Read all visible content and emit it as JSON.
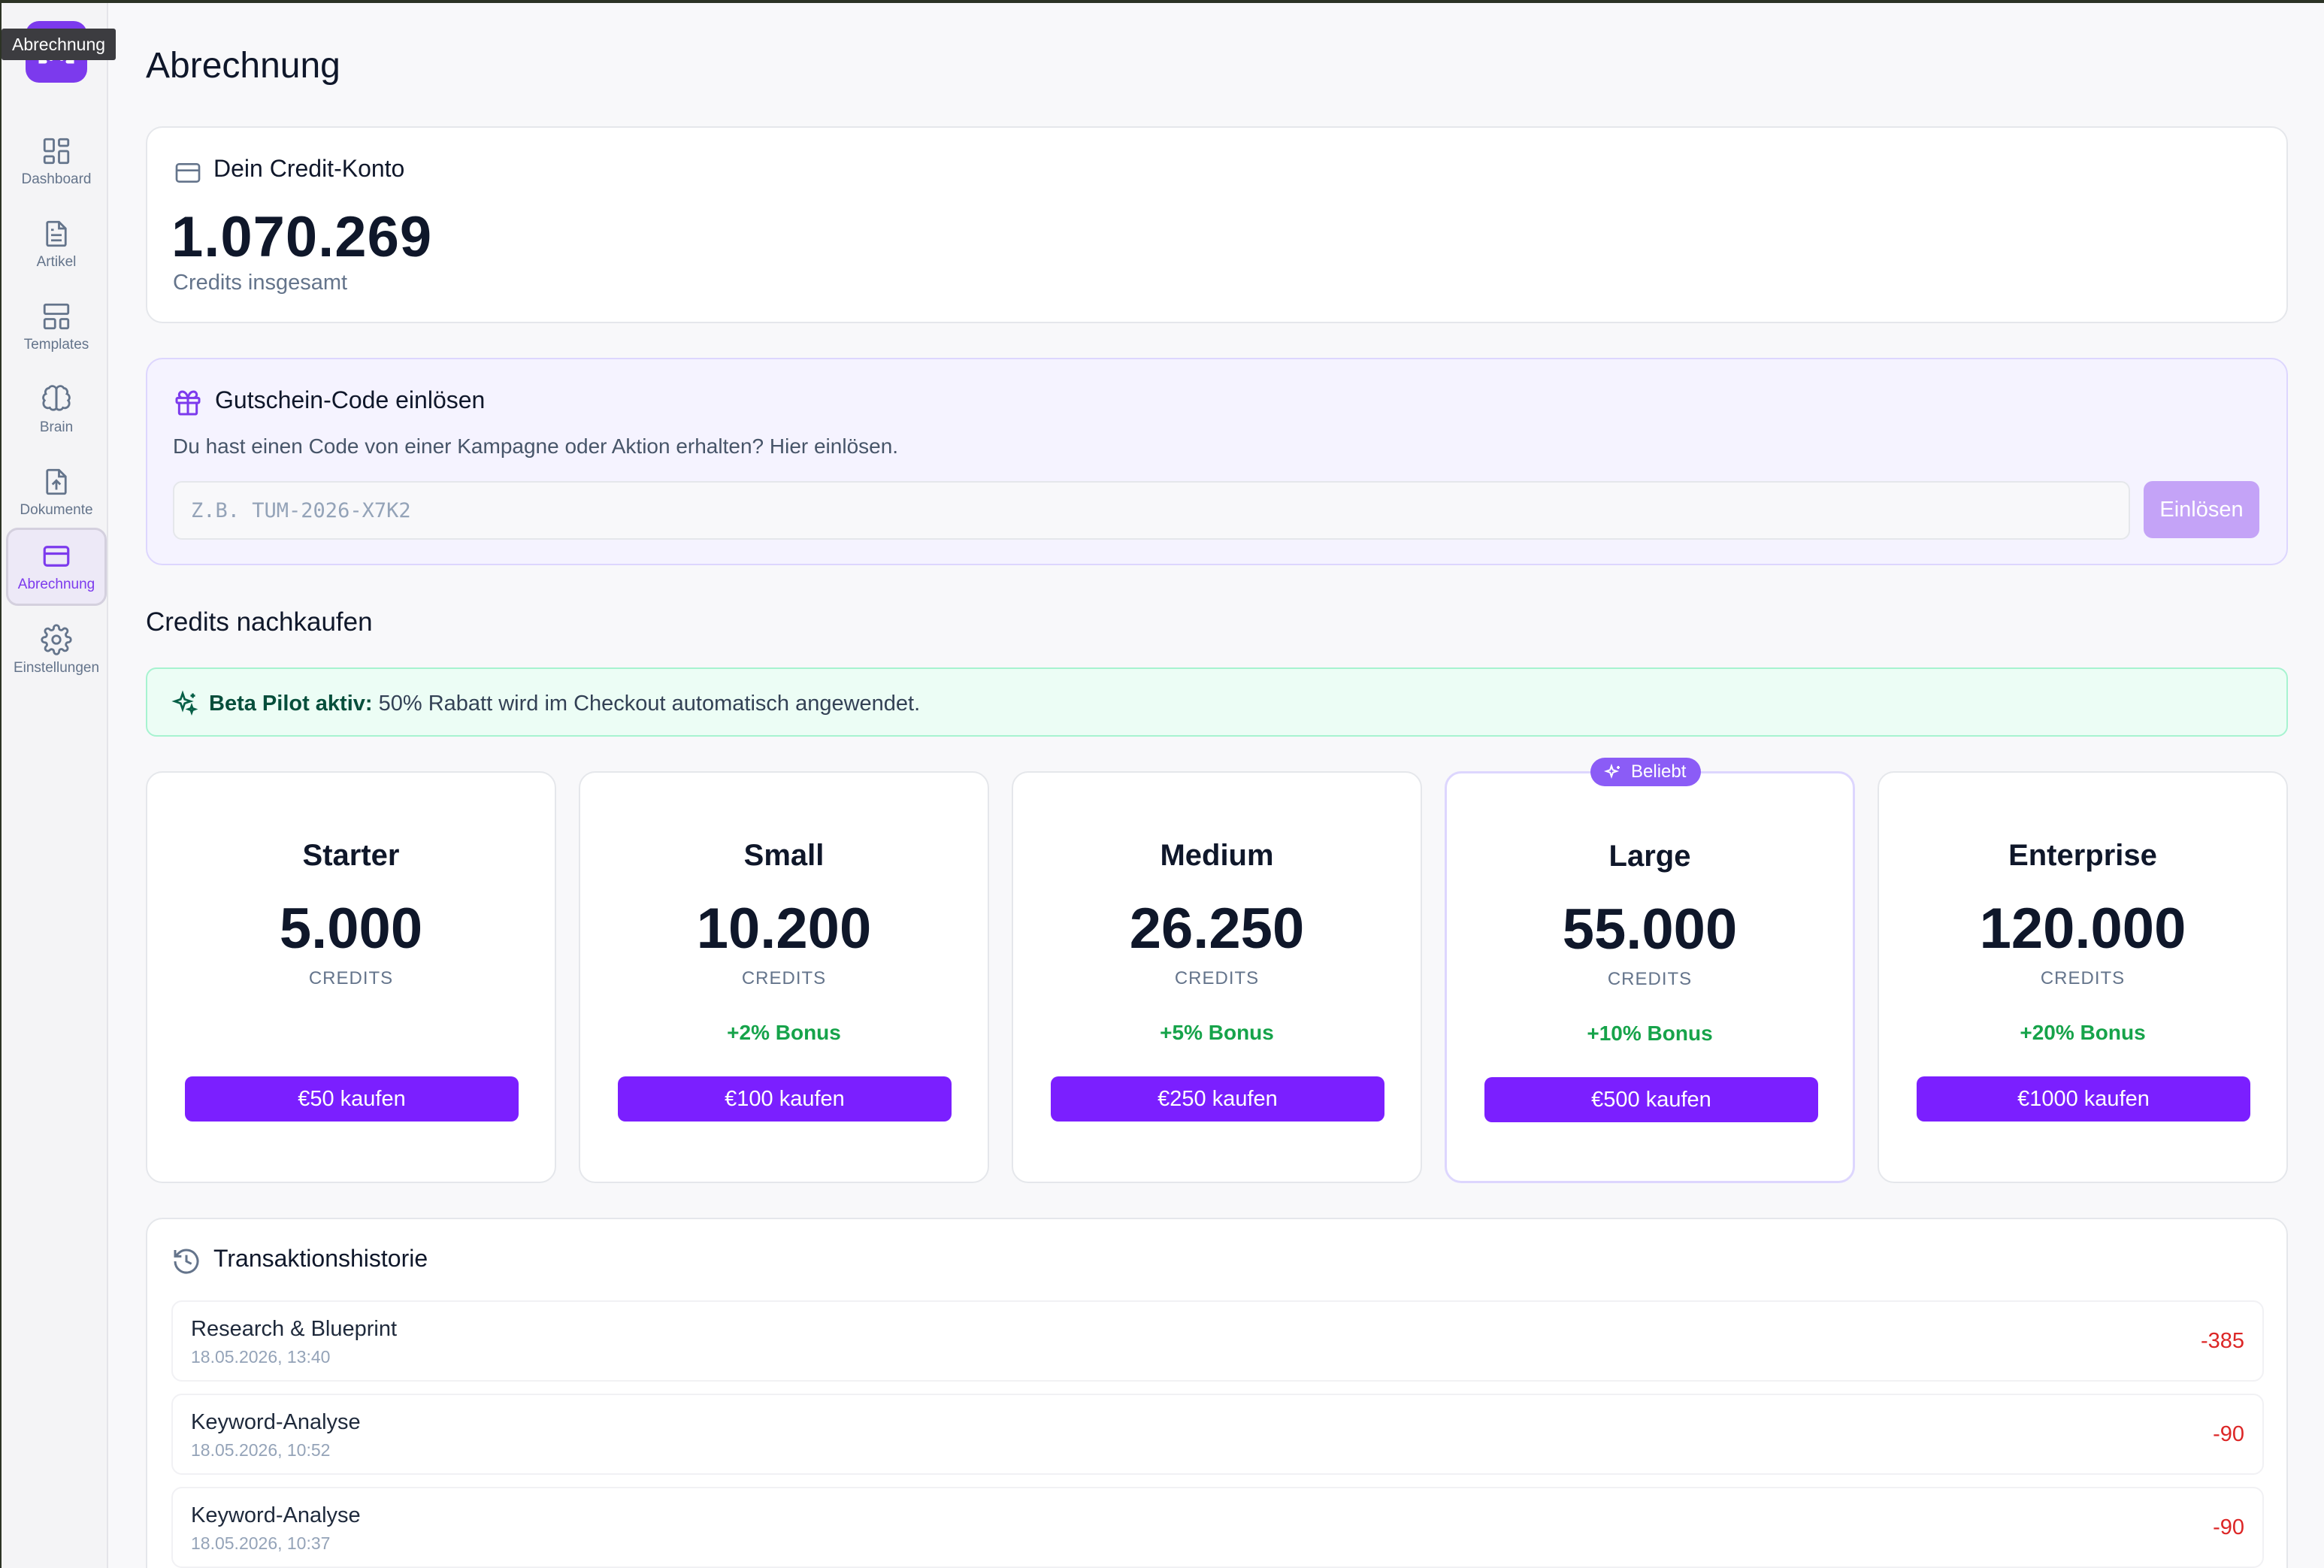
{
  "tooltip": "Abrechnung",
  "sidebar": {
    "items": [
      {
        "label": "Dashboard"
      },
      {
        "label": "Artikel"
      },
      {
        "label": "Templates"
      },
      {
        "label": "Brain"
      },
      {
        "label": "Dokumente"
      },
      {
        "label": "Abrechnung",
        "active": true
      },
      {
        "label": "Einstellungen"
      }
    ]
  },
  "page": {
    "title": "Abrechnung"
  },
  "account": {
    "title": "Dein Credit-Konto",
    "balance": "1.070.269",
    "balance_label": "Credits insgesamt"
  },
  "voucher": {
    "title": "Gutschein-Code einlösen",
    "description": "Du hast einen Code von einer Kampagne oder Aktion erhalten? Hier einlösen.",
    "placeholder": "Z.B. TUM-2026-X7K2",
    "value": "",
    "button_label": "Einlösen"
  },
  "buy": {
    "title": "Credits nachkaufen",
    "promo_strong": "Beta Pilot aktiv:",
    "promo_text": " 50% Rabatt wird im Checkout automatisch angewendet.",
    "popular_badge": "Beliebt",
    "plans": [
      {
        "name": "Starter",
        "credits": "5.000",
        "unit": "CREDITS",
        "bonus": "",
        "button": "€50 kaufen"
      },
      {
        "name": "Small",
        "credits": "10.200",
        "unit": "CREDITS",
        "bonus": "+2% Bonus",
        "button": "€100 kaufen"
      },
      {
        "name": "Medium",
        "credits": "26.250",
        "unit": "CREDITS",
        "bonus": "+5% Bonus",
        "button": "€250 kaufen"
      },
      {
        "name": "Large",
        "credits": "55.000",
        "unit": "CREDITS",
        "bonus": "+10% Bonus",
        "button": "€500 kaufen",
        "popular": true
      },
      {
        "name": "Enterprise",
        "credits": "120.000",
        "unit": "CREDITS",
        "bonus": "+20% Bonus",
        "button": "€1000 kaufen"
      }
    ]
  },
  "history": {
    "title": "Transaktionshistorie",
    "rows": [
      {
        "title": "Research & Blueprint",
        "date": "18.05.2026, 13:40",
        "amount": "-385"
      },
      {
        "title": "Keyword-Analyse",
        "date": "18.05.2026, 10:52",
        "amount": "-90"
      },
      {
        "title": "Keyword-Analyse",
        "date": "18.05.2026, 10:37",
        "amount": "-90"
      }
    ]
  },
  "colors": {
    "accent": "#7c3aed",
    "button": "#7b1fff",
    "bonus": "#16a34a",
    "negative": "#dc2626"
  },
  "icons": {
    "logo": "brackets-logo-icon",
    "nav": [
      "dashboard-grid-icon",
      "document-icon",
      "templates-layout-icon",
      "brain-icon",
      "file-upload-icon",
      "credit-card-icon",
      "gear-icon"
    ],
    "account": "credit-card-icon",
    "voucher": "gift-icon",
    "promo": "sparkles-icon",
    "history": "history-clock-icon"
  }
}
